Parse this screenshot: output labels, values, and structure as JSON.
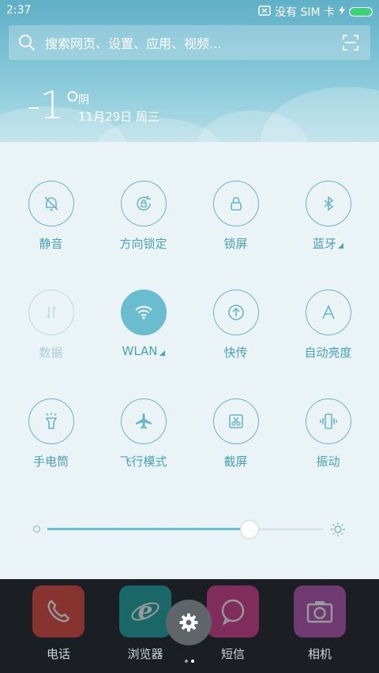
{
  "status": {
    "time": "2:37",
    "sim_text": "没有 SIM 卡",
    "battery_color": "#3bd66a"
  },
  "search": {
    "placeholder": "搜索网页、设置、应用、视频..."
  },
  "weather": {
    "temp": "-1°",
    "condition": "阴",
    "date": "11月29日 周三"
  },
  "toggles": [
    {
      "label": "静音",
      "icon": "bell-off-icon",
      "state": "off"
    },
    {
      "label": "方向锁定",
      "icon": "rotation-lock-icon",
      "state": "off"
    },
    {
      "label": "锁屏",
      "icon": "lock-icon",
      "state": "off"
    },
    {
      "label": "蓝牙",
      "icon": "bluetooth-icon",
      "state": "off",
      "has_more": true
    },
    {
      "label": "数据",
      "icon": "mobile-data-icon",
      "state": "disabled"
    },
    {
      "label": "WLAN",
      "icon": "wifi-icon",
      "state": "on",
      "has_more": true
    },
    {
      "label": "快传",
      "icon": "quick-share-icon",
      "state": "off"
    },
    {
      "label": "自动亮度",
      "icon": "auto-brightness-icon",
      "state": "off"
    },
    {
      "label": "手电筒",
      "icon": "flashlight-icon",
      "state": "off"
    },
    {
      "label": "飞行模式",
      "icon": "airplane-icon",
      "state": "off"
    },
    {
      "label": "截屏",
      "icon": "screenshot-icon",
      "state": "off"
    },
    {
      "label": "振动",
      "icon": "vibrate-icon",
      "state": "off"
    }
  ],
  "brightness": {
    "value_fraction": 0.73
  },
  "dock": {
    "apps": [
      {
        "label": "电话",
        "icon": "phone-icon",
        "color": "#e0443b"
      },
      {
        "label": "浏览器",
        "icon": "browser-icon",
        "color": "#1aa3a0"
      },
      {
        "label": "短信",
        "icon": "sms-icon",
        "color": "#d23c8c"
      },
      {
        "label": "相机",
        "icon": "camera-icon",
        "color": "#b44fb3"
      }
    ]
  },
  "colors": {
    "accent": "#69bdcf",
    "label": "#4aa2b8",
    "panel_bg": "#eaf3f6"
  }
}
